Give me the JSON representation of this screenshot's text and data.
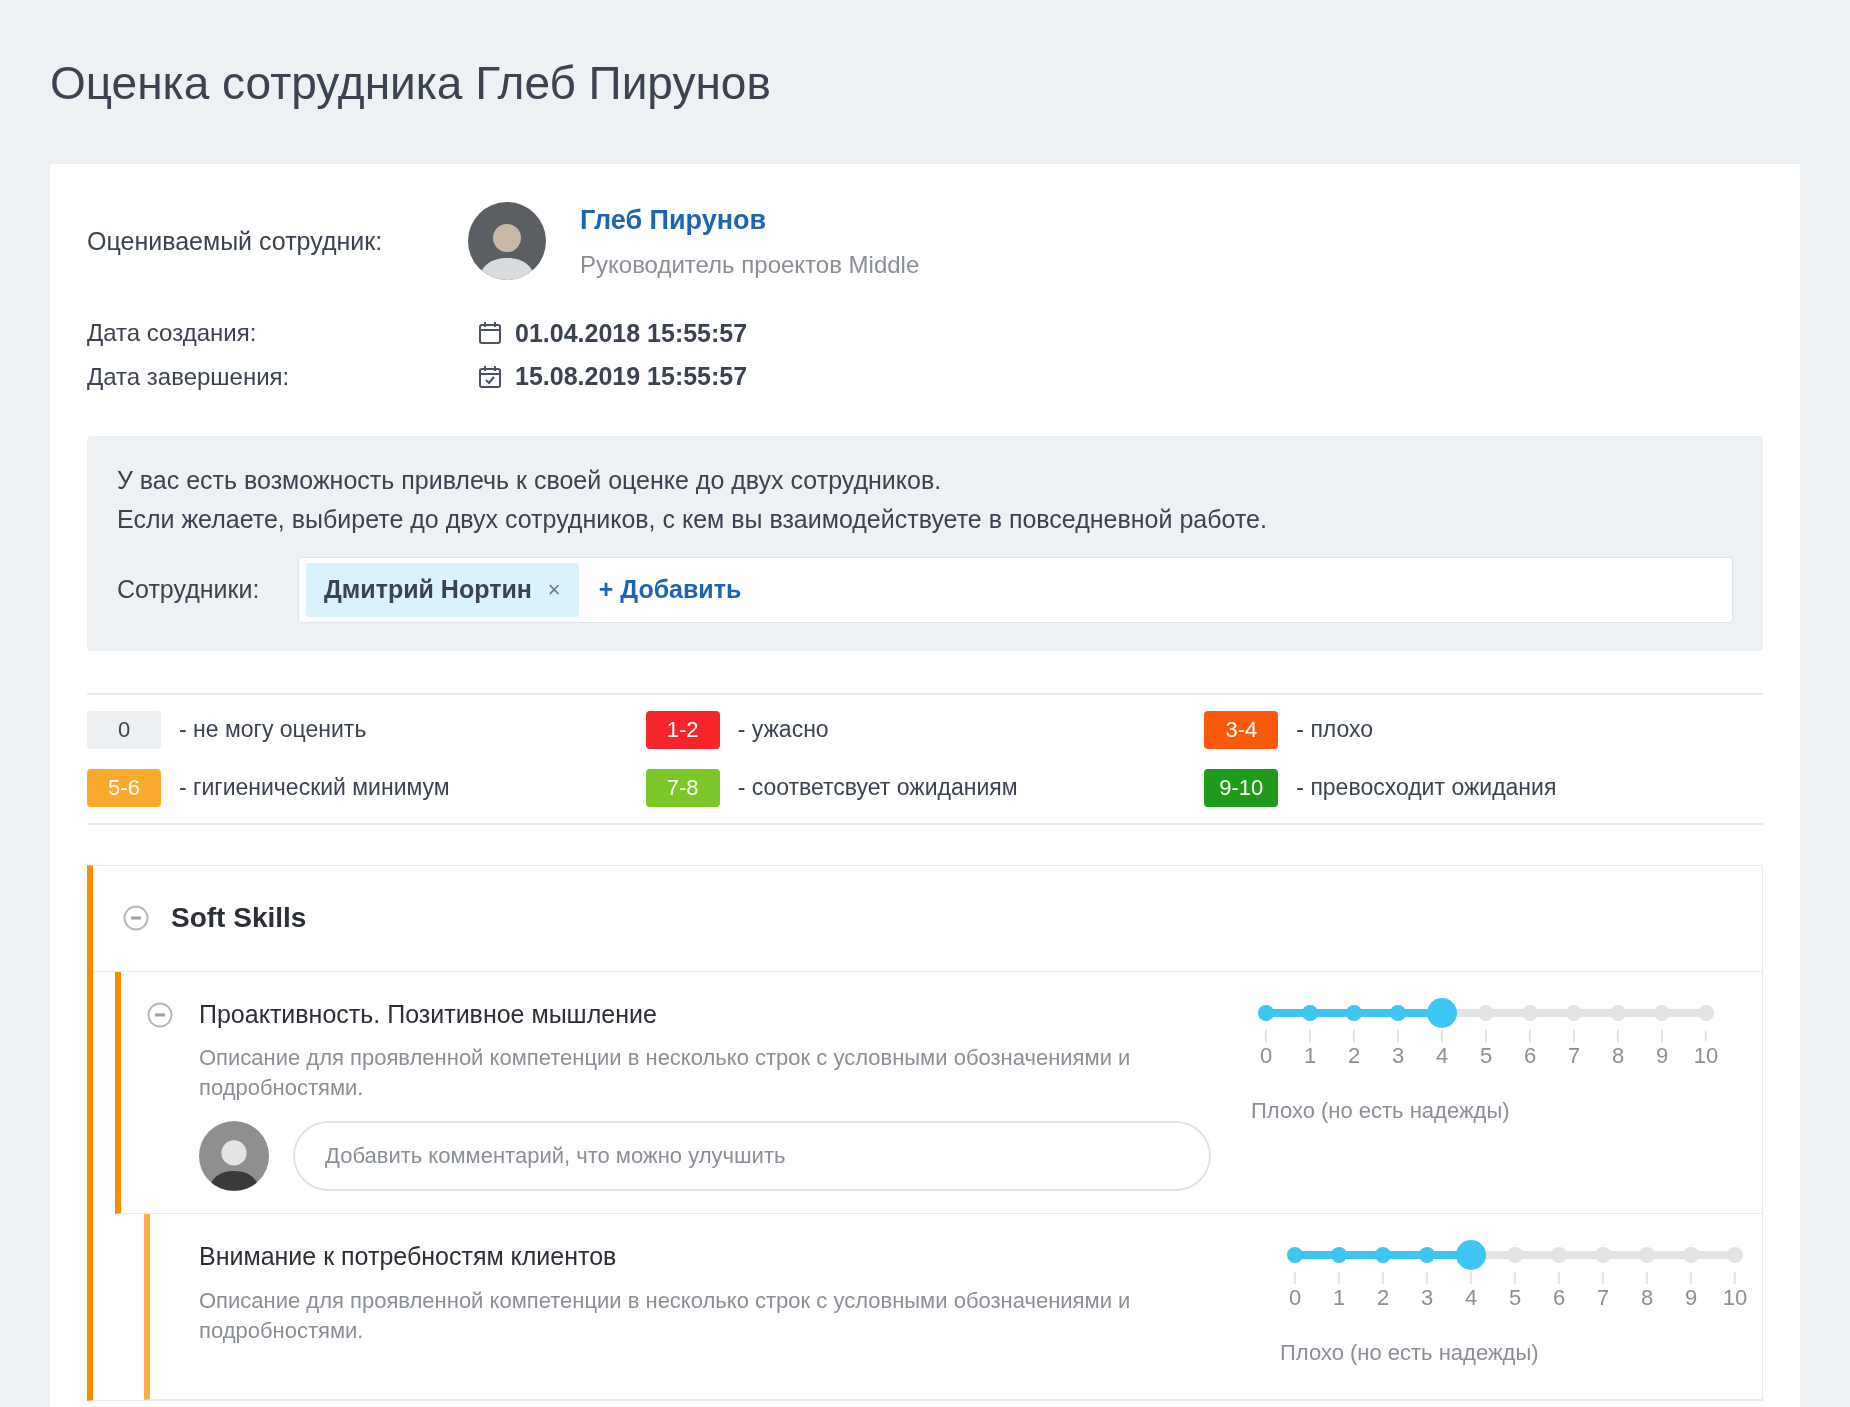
{
  "page_title": "Оценка сотрудника Глеб Пирунов",
  "employee": {
    "label": "Оцениваемый сотрудник:",
    "name": "Глеб Пирунов",
    "role": "Руководитель проектов Middle"
  },
  "dates": [
    {
      "label": "Дата создания:",
      "value": "01.04.2018 15:55:57",
      "kind": "created"
    },
    {
      "label": "Дата завершения:",
      "value": "15.08.2019 15:55:57",
      "kind": "finished"
    }
  ],
  "reviewers": {
    "lines": [
      "У вас есть возможность привлечь к своей оценке до двух сотрудников.",
      "Если желаете, выбирете до двух сотрудников, с кем вы взаимодействуете в повседневной работе."
    ],
    "label": "Сотрудники:",
    "chips": [
      {
        "label": "Дмитрий Нортин",
        "remove": "×"
      }
    ],
    "add": "+ Добавить"
  },
  "legend": [
    {
      "badge": "0",
      "text": "- не могу оценить",
      "color": "#eceff2"
    },
    {
      "badge": "1-2",
      "text": "- ужасно",
      "color": "#f5262a"
    },
    {
      "badge": "3-4",
      "text": "- плохо",
      "color": "#fb5a0e"
    },
    {
      "badge": "5-6",
      "text": "- гигиенический минимум",
      "color": "#fcaa2f"
    },
    {
      "badge": "7-8",
      "text": "- соответсвует ожиданиям",
      "color": "#7cc62a"
    },
    {
      "badge": "9-10",
      "text": "- превосходит ожидания",
      "color": "#1e9b1b"
    }
  ],
  "section": {
    "title": "Soft Skills",
    "expanded": true,
    "items": [
      {
        "title": "Проактивность. Позитивное мышление",
        "expanded": true,
        "description": "Описание для проявленной компетенции в несколько строк с условными обозначениями и подробностями.",
        "comment": {
          "placeholder": "Добавить комментарий, что можно улучшить"
        },
        "level": 0.4,
        "scale": [
          "0",
          "1",
          "2",
          "3",
          "4",
          "5",
          "6",
          "7",
          "8",
          "9",
          "10"
        ],
        "rating": "Плохо (но есть надежды)"
      },
      {
        "title": "Внимание к потребностям клиентов",
        "description": "Описание для проявленной компетенции в несколько строк с условными обозначениями и подробностями.",
        "level": 0.4,
        "scale": [
          "0",
          "1",
          "2",
          "3",
          "4",
          "5",
          "6",
          "7",
          "8",
          "9",
          "10"
        ],
        "rating": "Плохо (но есть надежды)"
      }
    ]
  }
}
